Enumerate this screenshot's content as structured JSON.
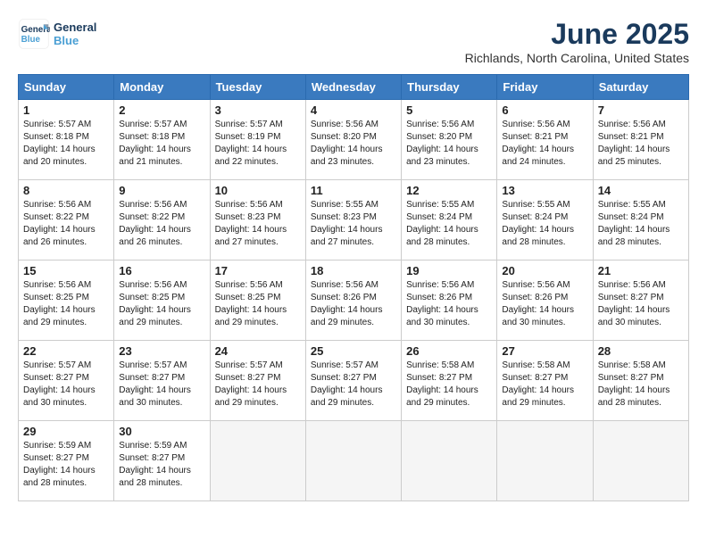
{
  "logo": {
    "line1": "General",
    "line2": "Blue"
  },
  "title": "June 2025",
  "subtitle": "Richlands, North Carolina, United States",
  "days_of_week": [
    "Sunday",
    "Monday",
    "Tuesday",
    "Wednesday",
    "Thursday",
    "Friday",
    "Saturday"
  ],
  "weeks": [
    [
      {
        "day": "1",
        "info": "Sunrise: 5:57 AM\nSunset: 8:18 PM\nDaylight: 14 hours\nand 20 minutes."
      },
      {
        "day": "2",
        "info": "Sunrise: 5:57 AM\nSunset: 8:18 PM\nDaylight: 14 hours\nand 21 minutes."
      },
      {
        "day": "3",
        "info": "Sunrise: 5:57 AM\nSunset: 8:19 PM\nDaylight: 14 hours\nand 22 minutes."
      },
      {
        "day": "4",
        "info": "Sunrise: 5:56 AM\nSunset: 8:20 PM\nDaylight: 14 hours\nand 23 minutes."
      },
      {
        "day": "5",
        "info": "Sunrise: 5:56 AM\nSunset: 8:20 PM\nDaylight: 14 hours\nand 23 minutes."
      },
      {
        "day": "6",
        "info": "Sunrise: 5:56 AM\nSunset: 8:21 PM\nDaylight: 14 hours\nand 24 minutes."
      },
      {
        "day": "7",
        "info": "Sunrise: 5:56 AM\nSunset: 8:21 PM\nDaylight: 14 hours\nand 25 minutes."
      }
    ],
    [
      {
        "day": "8",
        "info": "Sunrise: 5:56 AM\nSunset: 8:22 PM\nDaylight: 14 hours\nand 26 minutes."
      },
      {
        "day": "9",
        "info": "Sunrise: 5:56 AM\nSunset: 8:22 PM\nDaylight: 14 hours\nand 26 minutes."
      },
      {
        "day": "10",
        "info": "Sunrise: 5:56 AM\nSunset: 8:23 PM\nDaylight: 14 hours\nand 27 minutes."
      },
      {
        "day": "11",
        "info": "Sunrise: 5:55 AM\nSunset: 8:23 PM\nDaylight: 14 hours\nand 27 minutes."
      },
      {
        "day": "12",
        "info": "Sunrise: 5:55 AM\nSunset: 8:24 PM\nDaylight: 14 hours\nand 28 minutes."
      },
      {
        "day": "13",
        "info": "Sunrise: 5:55 AM\nSunset: 8:24 PM\nDaylight: 14 hours\nand 28 minutes."
      },
      {
        "day": "14",
        "info": "Sunrise: 5:55 AM\nSunset: 8:24 PM\nDaylight: 14 hours\nand 28 minutes."
      }
    ],
    [
      {
        "day": "15",
        "info": "Sunrise: 5:56 AM\nSunset: 8:25 PM\nDaylight: 14 hours\nand 29 minutes."
      },
      {
        "day": "16",
        "info": "Sunrise: 5:56 AM\nSunset: 8:25 PM\nDaylight: 14 hours\nand 29 minutes."
      },
      {
        "day": "17",
        "info": "Sunrise: 5:56 AM\nSunset: 8:25 PM\nDaylight: 14 hours\nand 29 minutes."
      },
      {
        "day": "18",
        "info": "Sunrise: 5:56 AM\nSunset: 8:26 PM\nDaylight: 14 hours\nand 29 minutes."
      },
      {
        "day": "19",
        "info": "Sunrise: 5:56 AM\nSunset: 8:26 PM\nDaylight: 14 hours\nand 30 minutes."
      },
      {
        "day": "20",
        "info": "Sunrise: 5:56 AM\nSunset: 8:26 PM\nDaylight: 14 hours\nand 30 minutes."
      },
      {
        "day": "21",
        "info": "Sunrise: 5:56 AM\nSunset: 8:27 PM\nDaylight: 14 hours\nand 30 minutes."
      }
    ],
    [
      {
        "day": "22",
        "info": "Sunrise: 5:57 AM\nSunset: 8:27 PM\nDaylight: 14 hours\nand 30 minutes."
      },
      {
        "day": "23",
        "info": "Sunrise: 5:57 AM\nSunset: 8:27 PM\nDaylight: 14 hours\nand 30 minutes."
      },
      {
        "day": "24",
        "info": "Sunrise: 5:57 AM\nSunset: 8:27 PM\nDaylight: 14 hours\nand 29 minutes."
      },
      {
        "day": "25",
        "info": "Sunrise: 5:57 AM\nSunset: 8:27 PM\nDaylight: 14 hours\nand 29 minutes."
      },
      {
        "day": "26",
        "info": "Sunrise: 5:58 AM\nSunset: 8:27 PM\nDaylight: 14 hours\nand 29 minutes."
      },
      {
        "day": "27",
        "info": "Sunrise: 5:58 AM\nSunset: 8:27 PM\nDaylight: 14 hours\nand 29 minutes."
      },
      {
        "day": "28",
        "info": "Sunrise: 5:58 AM\nSunset: 8:27 PM\nDaylight: 14 hours\nand 28 minutes."
      }
    ],
    [
      {
        "day": "29",
        "info": "Sunrise: 5:59 AM\nSunset: 8:27 PM\nDaylight: 14 hours\nand 28 minutes."
      },
      {
        "day": "30",
        "info": "Sunrise: 5:59 AM\nSunset: 8:27 PM\nDaylight: 14 hours\nand 28 minutes."
      },
      {
        "day": "",
        "info": ""
      },
      {
        "day": "",
        "info": ""
      },
      {
        "day": "",
        "info": ""
      },
      {
        "day": "",
        "info": ""
      },
      {
        "day": "",
        "info": ""
      }
    ]
  ]
}
